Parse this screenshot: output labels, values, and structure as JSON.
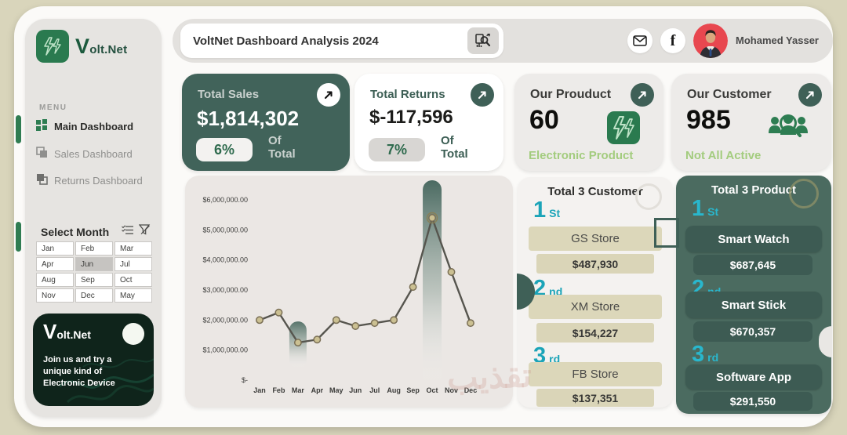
{
  "sidebar": {
    "logo": {
      "v": "V",
      "rest": "olt.Net"
    },
    "menu_label": "MENU",
    "items": [
      {
        "label": "Main Dashboard",
        "active": true
      },
      {
        "label": "Sales Dashboard",
        "active": false
      },
      {
        "label": "Returns Dashboard",
        "active": false
      }
    ],
    "select_month": {
      "title": "Select Month",
      "months": [
        "Jan",
        "Feb",
        "Mar",
        "Apr",
        "Jun",
        "Jul",
        "Aug",
        "Sep",
        "Oct",
        "Nov",
        "Dec",
        "May"
      ],
      "selected": "Jun"
    },
    "promo": {
      "brand_v": "V",
      "brand_rest": "olt.Net",
      "text": "Join us and try a unique kind of Electronic Device"
    }
  },
  "header": {
    "title": "VoltNet Dashboard Analysis 2024",
    "user_name": "Mohamed Yasser"
  },
  "kpis": {
    "sales": {
      "title": "Total Sales",
      "value": "$1,814,302",
      "percent": "6%",
      "of_label": "Of Total"
    },
    "returns": {
      "title": "Total Returns",
      "value": "$-117,596",
      "percent": "7%",
      "of_label": "Of Total"
    },
    "product": {
      "title": "Our Prouduct",
      "value": "60",
      "caption": "Electronic Product"
    },
    "customer": {
      "title": "Our Customer",
      "value": "985",
      "caption": "Not All Active"
    }
  },
  "chart_data": {
    "type": "line",
    "categories": [
      "Jan",
      "Feb",
      "Mar",
      "Apr",
      "May",
      "Jun",
      "Jul",
      "Aug",
      "Sep",
      "Oct",
      "Nov",
      "Dec"
    ],
    "values": [
      2000000,
      2250000,
      1250000,
      1350000,
      2000000,
      1800000,
      1900000,
      2000000,
      3100000,
      5400000,
      3600000,
      1900000
    ],
    "title": "",
    "xlabel": "",
    "ylabel": "",
    "ylim": [
      0,
      6000000
    ],
    "ytick_labels": [
      "$6,000,000.00",
      "$5,000,000.00",
      "$4,000,000.00",
      "$3,000,000.00",
      "$2,000,000.00",
      "$1,000,000.00",
      "$-"
    ],
    "grid": false,
    "legend": false,
    "highlights": "gradient pill bands behind min (Mar) and max (Oct) points"
  },
  "top_customers": {
    "title": "Total 3 Customer",
    "ranks": [
      {
        "rank": "1",
        "suffix": "St",
        "name": "GS Store",
        "value": "$487,930"
      },
      {
        "rank": "2",
        "suffix": "nd",
        "name": "XM Store",
        "value": "$154,227"
      },
      {
        "rank": "3",
        "suffix": "rd",
        "name": "FB Store",
        "value": "$137,351"
      }
    ]
  },
  "top_products": {
    "title": "Total 3 Product",
    "ranks": [
      {
        "rank": "1",
        "suffix": "St",
        "name": "Smart Watch",
        "value": "$687,645"
      },
      {
        "rank": "2",
        "suffix": "nd",
        "name": "Smart Stick",
        "value": "$670,357"
      },
      {
        "rank": "3",
        "suffix": "rd",
        "name": "Software App",
        "value": "$291,550"
      }
    ]
  },
  "watermark": "تقذيب"
}
